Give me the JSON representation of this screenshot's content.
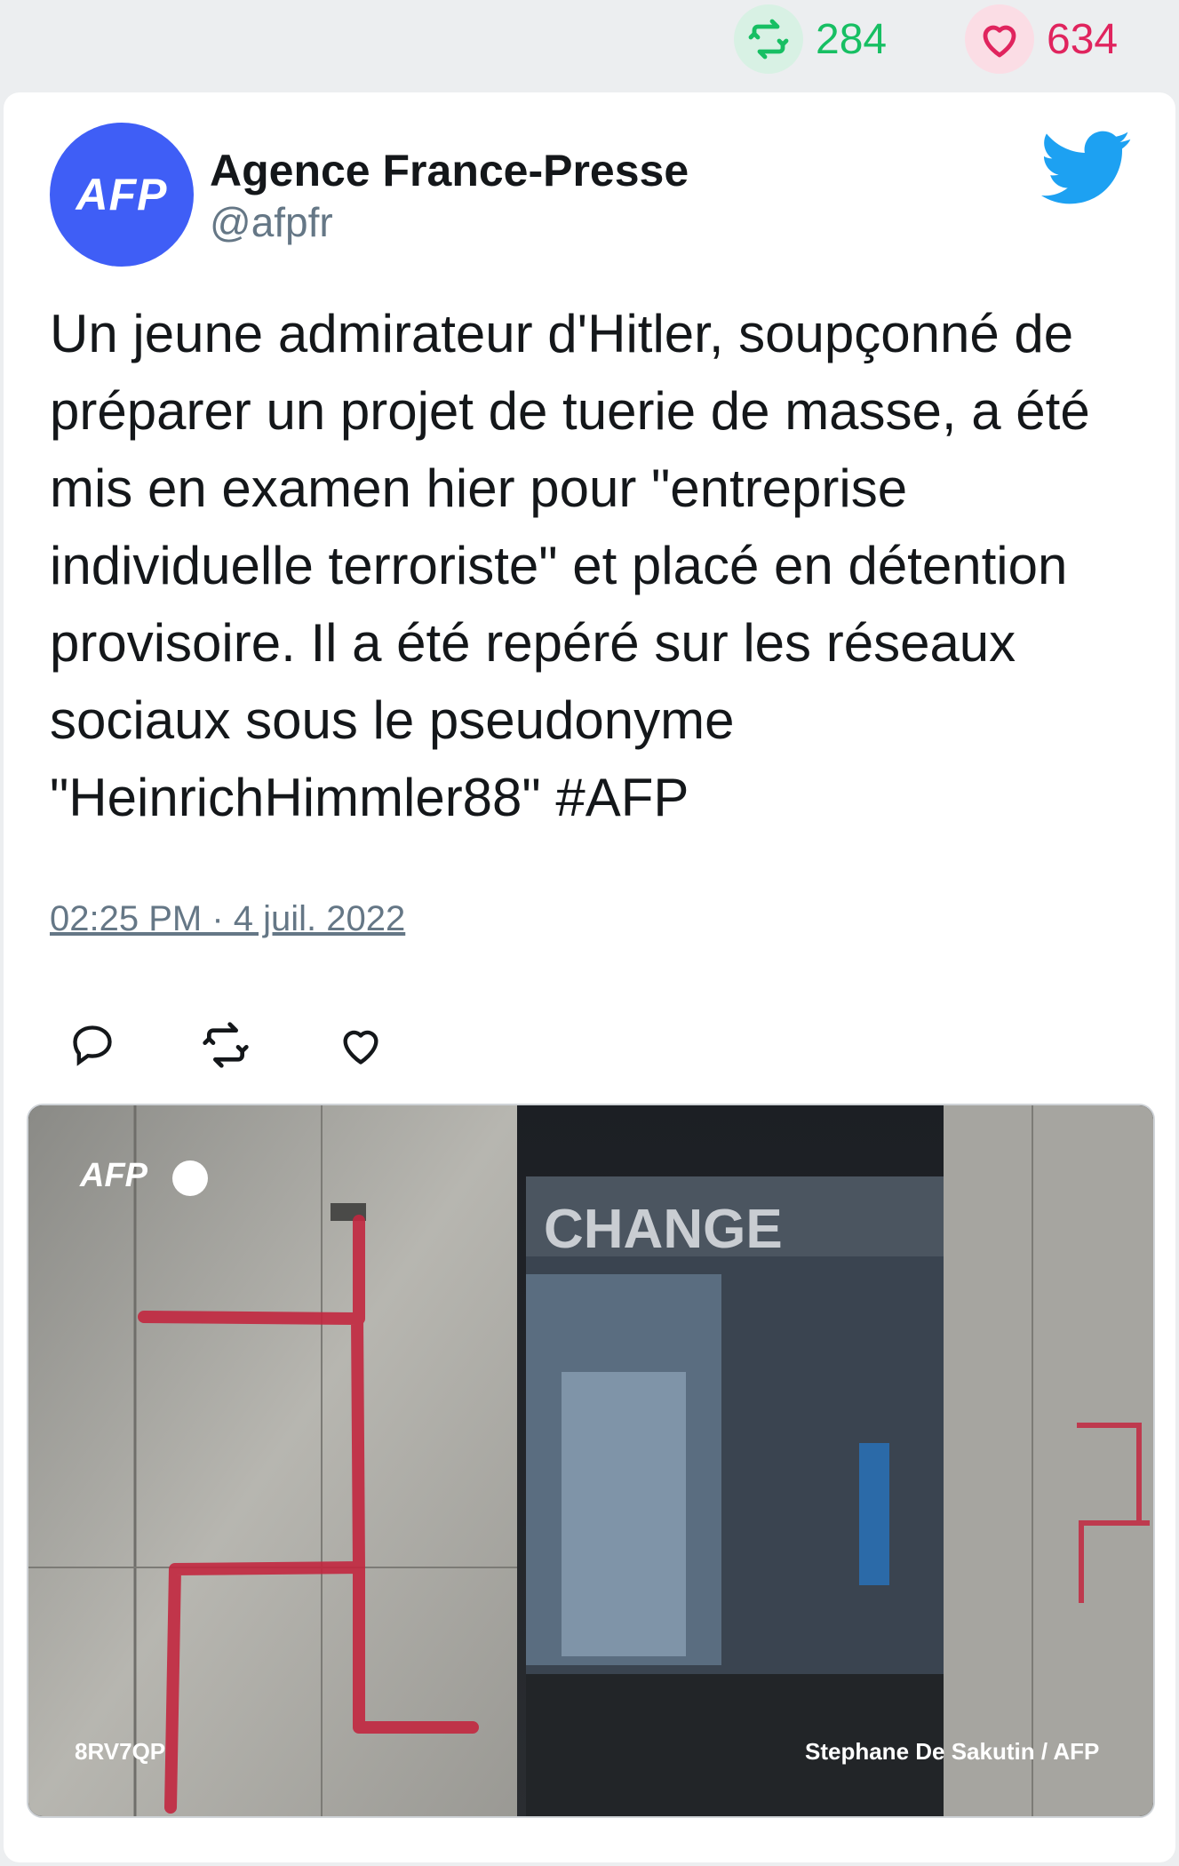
{
  "stats": {
    "retweets": "284",
    "likes": "634"
  },
  "author": {
    "name": "Agence France-Presse",
    "handle": "@afpfr",
    "avatar_text": "AFP"
  },
  "tweet": {
    "text": "Un jeune admirateur d'Hitler, soupçonné de préparer un projet de tuerie de masse, a été mis en examen hier pour \"entreprise individuelle terroriste\" et placé en détention provisoire. Il a été repéré sur les réseaux sociaux sous le pseudonyme \"HeinrichHimmler88\" #AFP",
    "timestamp": "02:25 PM · 4 juil. 2022"
  },
  "photo": {
    "watermark": "AFP",
    "id": "8RV7QP",
    "credit": "Stephane De Sakutin / AFP",
    "sign_text": "CHANGE"
  },
  "icons": {
    "retweet": "retweet-icon",
    "like": "heart-icon",
    "reply": "reply-icon",
    "bird": "twitter-bird-icon"
  },
  "colors": {
    "retweet_green": "#17bf63",
    "like_red": "#e0245e",
    "twitter_blue": "#1da1f2",
    "avatar_blue": "#3f5ef6"
  }
}
